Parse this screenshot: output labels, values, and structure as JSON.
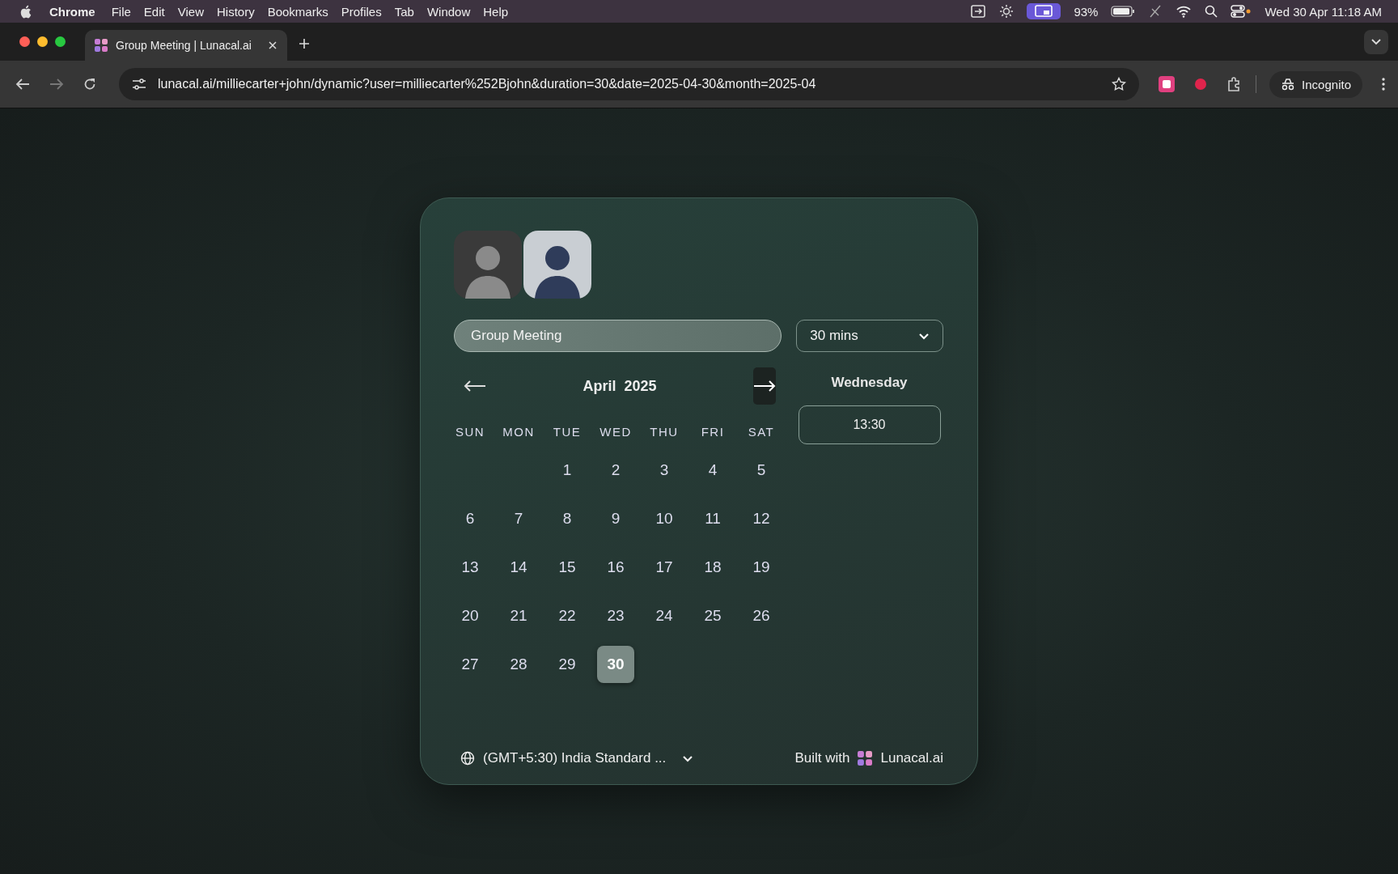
{
  "menu_bar": {
    "app": "Chrome",
    "items": [
      "File",
      "Edit",
      "View",
      "History",
      "Bookmarks",
      "Profiles",
      "Tab",
      "Window",
      "Help"
    ],
    "battery": "93%",
    "clock": "Wed 30 Apr  11:18 AM"
  },
  "tab": {
    "title": "Group Meeting | Lunacal.ai",
    "selected": true
  },
  "address_bar": {
    "url": "lunacal.ai/milliecarter+john/dynamic?user=milliecarter%252Bjohn&duration=30&date=2025-04-30&month=2025-04",
    "profile": "Incognito"
  },
  "booking": {
    "title": "Group Meeting",
    "duration": "30 mins",
    "calendar": {
      "month": "April",
      "year": "2025",
      "weekdays": [
        "SUN",
        "MON",
        "TUE",
        "WED",
        "THU",
        "FRI",
        "SAT"
      ],
      "weeks": [
        [
          {
            "label": "1",
            "selected": false
          },
          {
            "label": "2",
            "selected": false
          },
          {
            "label": "3",
            "selected": false
          },
          {
            "label": "4",
            "selected": false
          },
          {
            "label": "5",
            "selected": false
          }
        ],
        [
          {
            "label": "6",
            "selected": false
          },
          {
            "label": "7",
            "selected": false
          },
          {
            "label": "8",
            "selected": false
          },
          {
            "label": "9",
            "selected": false
          },
          {
            "label": "10",
            "selected": false
          },
          {
            "label": "11",
            "selected": false
          },
          {
            "label": "12",
            "selected": false
          }
        ],
        [
          {
            "label": "13",
            "selected": false
          },
          {
            "label": "14",
            "selected": false
          },
          {
            "label": "15",
            "selected": false
          },
          {
            "label": "16",
            "selected": false
          },
          {
            "label": "17",
            "selected": false
          },
          {
            "label": "18",
            "selected": false
          },
          {
            "label": "19",
            "selected": false
          }
        ],
        [
          {
            "label": "20",
            "selected": false
          },
          {
            "label": "21",
            "selected": false
          },
          {
            "label": "22",
            "selected": false
          },
          {
            "label": "23",
            "selected": false
          },
          {
            "label": "24",
            "selected": false
          },
          {
            "label": "25",
            "selected": false
          },
          {
            "label": "26",
            "selected": false
          }
        ],
        [
          {
            "label": "27",
            "selected": false
          },
          {
            "label": "28",
            "selected": false
          },
          {
            "label": "29",
            "selected": false
          },
          {
            "label": "30",
            "selected": true
          }
        ]
      ]
    },
    "day_heading": "Wednesday",
    "slots": [
      "13:30"
    ],
    "timezone": "(GMT+5:30) India Standard ...",
    "built_with": "Built with",
    "brand": "Lunacal.ai"
  }
}
